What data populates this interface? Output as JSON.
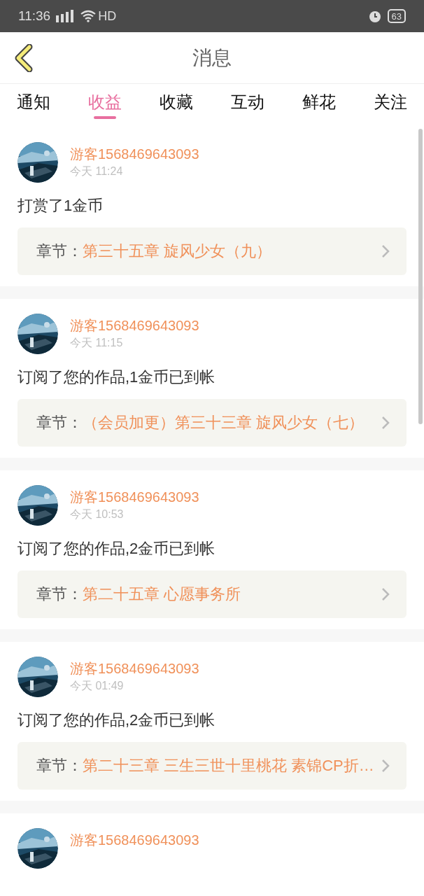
{
  "status_bar": {
    "time": "11:36",
    "network": "HD",
    "battery": "63"
  },
  "header": {
    "title": "消息"
  },
  "tabs": [
    {
      "label": "通知",
      "selected": false
    },
    {
      "label": "收益",
      "selected": true
    },
    {
      "label": "收藏",
      "selected": false
    },
    {
      "label": "互动",
      "selected": false
    },
    {
      "label": "鲜花",
      "selected": false
    },
    {
      "label": "关注",
      "selected": false
    }
  ],
  "messages": [
    {
      "user": "游客1568469643093",
      "time": "今天 11:24",
      "text": "打赏了1金币",
      "chapter_label": "章节：",
      "chapter": "第三十五章 旋风少女（九）"
    },
    {
      "user": "游客1568469643093",
      "time": "今天 11:15",
      "text": "订阅了您的作品,1金币已到帐",
      "chapter_label": "章节：",
      "chapter": "（会员加更）第三十三章 旋风少女（七）"
    },
    {
      "user": "游客1568469643093",
      "time": "今天 10:53",
      "text": "订阅了您的作品,2金币已到帐",
      "chapter_label": "章节：",
      "chapter": "第二十五章 心愿事务所"
    },
    {
      "user": "游客1568469643093",
      "time": "今天 01:49",
      "text": "订阅了您的作品,2金币已到帐",
      "chapter_label": "章节：",
      "chapter": "第二十三章 三生三世十里桃花 素锦CP折…"
    }
  ],
  "partial_message": {
    "user": "游客1568469643093"
  }
}
